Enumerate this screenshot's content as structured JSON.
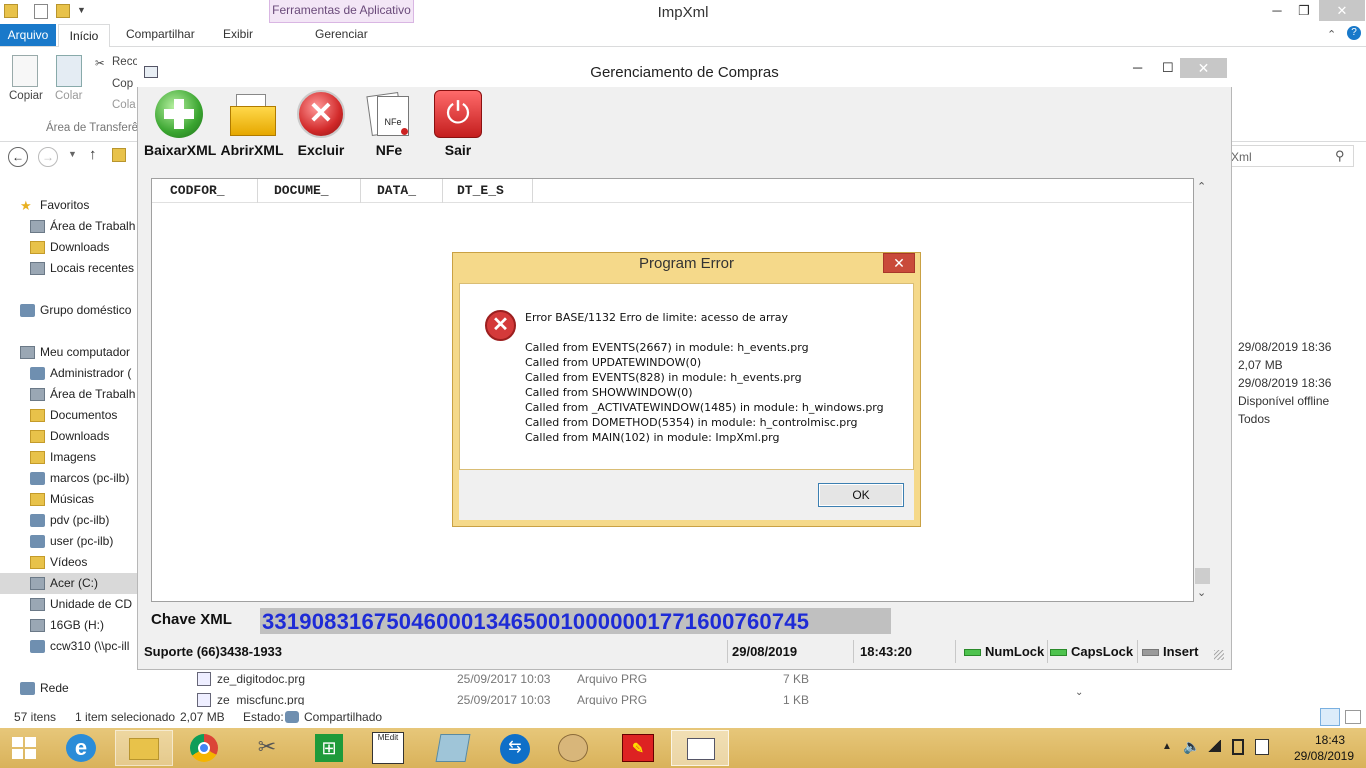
{
  "explorer": {
    "title": "ImpXml",
    "context_tab": "Ferramentas de Aplicativo",
    "tabs": {
      "arquivo": "Arquivo",
      "inicio": "Início",
      "compartilhar": "Compartilhar",
      "exibir": "Exibir",
      "gerenciar": "Gerenciar"
    },
    "ribbon": {
      "copiar": "Copiar",
      "colar": "Colar",
      "recortar": "Reco",
      "copiar_caminho": "Cop",
      "colar_atalho": "Cola",
      "group_label": "Área de Transferê"
    },
    "search_placeholder": "Xml",
    "nav": [
      {
        "label": "Favoritos",
        "icon": "star-icon"
      },
      {
        "label": "Área de Trabalh",
        "icon": "desktop-icon"
      },
      {
        "label": "Downloads",
        "icon": "folder-icon"
      },
      {
        "label": "Locais recentes",
        "icon": "recent-icon"
      },
      {
        "label": "Grupo doméstico",
        "icon": "homegroup-icon"
      },
      {
        "label": "Meu computador",
        "icon": "computer-icon"
      },
      {
        "label": "Administrador (",
        "icon": "network-drive-icon"
      },
      {
        "label": "Área de Trabalh",
        "icon": "desktop-icon"
      },
      {
        "label": "Documentos",
        "icon": "folder-icon"
      },
      {
        "label": "Downloads",
        "icon": "folder-icon"
      },
      {
        "label": "Imagens",
        "icon": "folder-icon"
      },
      {
        "label": "marcos (pc-ilb)",
        "icon": "network-drive-icon"
      },
      {
        "label": "Músicas",
        "icon": "folder-icon"
      },
      {
        "label": "pdv (pc-ilb)",
        "icon": "network-drive-icon"
      },
      {
        "label": "user (pc-ilb)",
        "icon": "network-drive-icon"
      },
      {
        "label": "Vídeos",
        "icon": "folder-icon"
      },
      {
        "label": "Acer (C:)",
        "icon": "drive-icon"
      },
      {
        "label": "Unidade de CD",
        "icon": "cd-icon"
      },
      {
        "label": "16GB (H:)",
        "icon": "usb-icon"
      },
      {
        "label": "ccw310 (\\\\pc-ill",
        "icon": "network-drive-icon"
      },
      {
        "label": "Rede",
        "icon": "network-icon"
      }
    ],
    "details": [
      "29/08/2019 18:36",
      "2,07 MB",
      "29/08/2019 18:36",
      "Disponível offline",
      "Todos"
    ],
    "files": [
      {
        "name": "ze_digitodoc.prg",
        "date": "25/09/2017 10:03",
        "type": "Arquivo PRG",
        "size": "7 KB"
      },
      {
        "name": "ze_miscfunc.prg",
        "date": "25/09/2017 10:03",
        "type": "Arquivo PRG",
        "size": "1 KB"
      }
    ],
    "status": {
      "items": "57 itens",
      "selected": "1 item selecionado",
      "size": "2,07 MB",
      "state_label": "Estado:",
      "state": "Compartilhado"
    }
  },
  "app": {
    "title": "Gerenciamento de Compras",
    "toolbar": [
      {
        "label": "BaixarXML",
        "icon": "download-plus-icon"
      },
      {
        "label": "AbrirXML",
        "icon": "open-folder-icon"
      },
      {
        "label": "Excluir",
        "icon": "delete-x-icon"
      },
      {
        "label": "NFe",
        "icon": "nfe-document-icon"
      },
      {
        "label": "Sair",
        "icon": "power-icon"
      }
    ],
    "columns": [
      "CODFOR_",
      "DOCUME_",
      "DATA_",
      "DT_E_S"
    ],
    "chave_label": "Chave XML",
    "chave_value": "33190831675046000134650010000001771600760745",
    "statusbar": {
      "suporte": "Suporte (66)3438-1933",
      "date": "29/08/2019",
      "time": "18:43:20",
      "numlock": "NumLock",
      "capslock": "CapsLock",
      "insert": "Insert"
    }
  },
  "dialog": {
    "title": "Program Error",
    "error_line": "Error BASE/1132  Erro de limite: acesso de array",
    "stack": [
      "Called from EVENTS(2667) in module: h_events.prg",
      "Called from UPDATEWINDOW(0)",
      "Called from EVENTS(828) in module: h_events.prg",
      "Called from SHOWWINDOW(0)",
      "Called from _ACTIVATEWINDOW(1485) in module: h_windows.prg",
      "Called from DOMETHOD(5354) in module: h_controlmisc.prg",
      "Called from MAIN(102) in module: ImpXml.prg"
    ],
    "ok_label": "OK"
  },
  "taskbar": {
    "time": "18:43",
    "date": "29/08/2019"
  }
}
